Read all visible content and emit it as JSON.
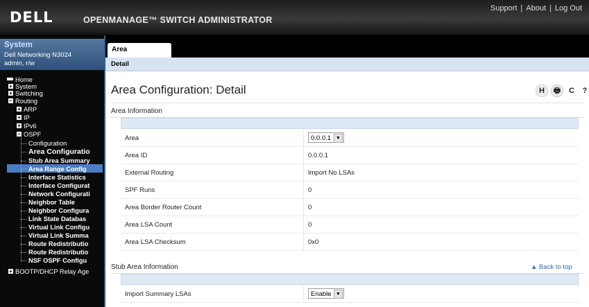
{
  "header": {
    "logo": "DELL",
    "brand": "OPENMANAGE™ SWITCH ADMINISTRATOR",
    "links": [
      "Support",
      "About",
      "Log Out"
    ]
  },
  "system_box": {
    "title": "System",
    "device": "Dell Networking N3024",
    "user": "admin, r/w"
  },
  "nav": {
    "items": [
      {
        "label": "Home",
        "icon": "home-icon"
      },
      {
        "label": "System",
        "toggle": "+"
      },
      {
        "label": "Switching",
        "toggle": "+"
      },
      {
        "label": "Routing",
        "toggle": "-"
      },
      {
        "label": "ARP",
        "toggle": "+"
      },
      {
        "label": "IP",
        "toggle": "+"
      },
      {
        "label": "IPv6",
        "toggle": "+"
      },
      {
        "label": "OSPF",
        "toggle": "-"
      },
      {
        "label": "Configuration"
      },
      {
        "label": "Area Configuratio"
      },
      {
        "label": "Stub Area Summary"
      },
      {
        "label": "Area Range Config"
      },
      {
        "label": "Interface Statistics"
      },
      {
        "label": "Interface Configurat"
      },
      {
        "label": "Network Configurati"
      },
      {
        "label": "Neighbor Table"
      },
      {
        "label": "Neighbor Configura"
      },
      {
        "label": "Link State Databas"
      },
      {
        "label": "Virtual Link Configu"
      },
      {
        "label": "Virtual Link Summa"
      },
      {
        "label": "Route Redistributio"
      },
      {
        "label": "Route Redistributio"
      },
      {
        "label": "NSF OSPF Configu"
      },
      {
        "label": "BOOTP/DHCP Relay Age",
        "toggle": "+"
      }
    ]
  },
  "tabs": {
    "main": "Area Configuration",
    "sub": "Detail"
  },
  "page": {
    "title": "Area Configuration: Detail",
    "icons": [
      "H",
      "🖶",
      "C",
      "?"
    ]
  },
  "area_info": {
    "heading": "Area Information",
    "rows": [
      {
        "label": "Area",
        "value": "0.0.0.1",
        "select": true
      },
      {
        "label": "Area ID",
        "value": "0.0.0.1"
      },
      {
        "label": "External Routing",
        "value": "Import No LSAs"
      },
      {
        "label": "SPF Runs",
        "value": "0"
      },
      {
        "label": "Area Border Router Count",
        "value": "0"
      },
      {
        "label": "Area LSA Count",
        "value": "0"
      },
      {
        "label": "Area LSA Checksum",
        "value": "0x0"
      }
    ]
  },
  "stub_info": {
    "heading": "Stub Area Information",
    "back_to_top": "▲ Back to top",
    "rows": [
      {
        "label": "Import Summary LSAs",
        "value": "Enable",
        "select": true
      }
    ]
  }
}
